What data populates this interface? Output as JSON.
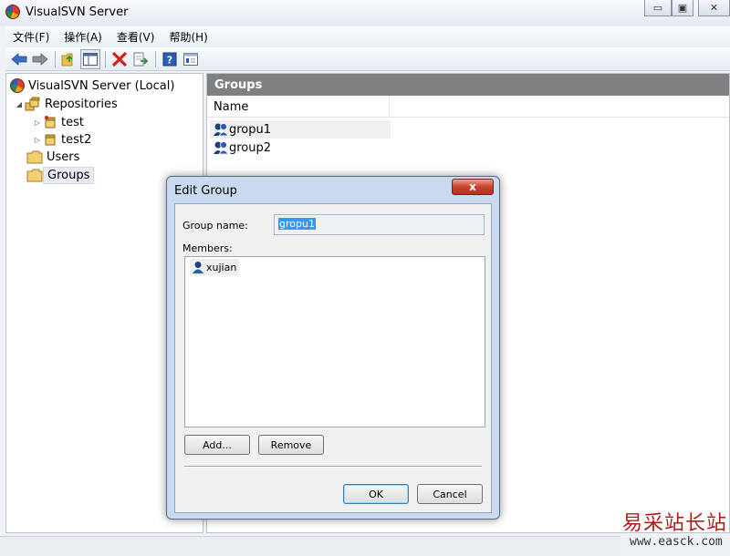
{
  "window": {
    "title": "VisualSVN Server",
    "minimize_glyph": "▭",
    "maximize_glyph": "▣",
    "close_glyph": "✕"
  },
  "menubar": {
    "items": [
      {
        "label": "文件(F)"
      },
      {
        "label": "操作(A)"
      },
      {
        "label": "查看(V)"
      },
      {
        "label": "帮助(H)"
      }
    ]
  },
  "toolbar": {
    "icons": [
      "back-arrow-icon",
      "forward-arrow-icon",
      "up-folder-icon",
      "show-hide-tree-icon",
      "delete-icon",
      "export-icon",
      "help-icon",
      "properties-icon"
    ],
    "colors": {
      "arrow": "#3a6fc9",
      "delete": "#d0201a",
      "help": "#2a5db8"
    }
  },
  "tree": {
    "root": "VisualSVN Server (Local)",
    "repositories": "Repositories",
    "repo_items": [
      "test",
      "test2"
    ],
    "users": "Users",
    "groups": "Groups"
  },
  "main": {
    "header": "Groups",
    "column_name": "Name",
    "rows": [
      "gropu1",
      "group2"
    ]
  },
  "dialog": {
    "title": "Edit Group",
    "close_label": "x",
    "group_name_label": "Group name:",
    "group_name_value": "gropu1",
    "members_label": "Members:",
    "members": [
      "xujian"
    ],
    "add_label": "Add...",
    "remove_label": "Remove",
    "ok_label": "OK",
    "cancel_label": "Cancel"
  },
  "watermark": {
    "text_cn": "易采站长站",
    "url": "www.easck.com"
  }
}
